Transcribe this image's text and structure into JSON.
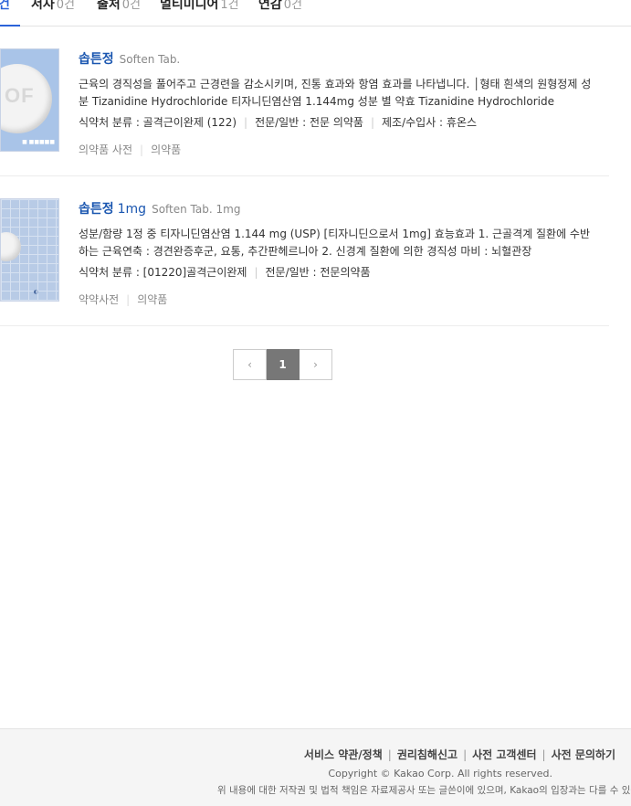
{
  "tabs": [
    {
      "label": "건",
      "count": ""
    },
    {
      "label": "서사",
      "count": "0건"
    },
    {
      "label": "출처",
      "count": "0건"
    },
    {
      "label": "멀티미디어",
      "count": "1건"
    },
    {
      "label": "연감",
      "count": "0건"
    }
  ],
  "results": [
    {
      "title": "솝튼정",
      "strength": "",
      "subtitle": "Soften Tab.",
      "thumb_text": "OF",
      "description": "근육의 경직성을 풀어주고 근경련을 감소시키며, 진통 효과와 항염 효과를 나타냅니다. │형태 흰색의 원형정제 성분 Tizanidine Hydrochloride 티자니딘염산염 1.144mg 성분 별 약효 Tizanidine Hydrochloride",
      "meta": [
        "식약처 분류 : 골격근이완제 (122)",
        "전문/일반 : 전문 의약품",
        "제조/수입사 : 휴온스"
      ],
      "categories": [
        "의약품 사전",
        "의약품"
      ]
    },
    {
      "title": "솝튼정",
      "strength": "1mg",
      "subtitle": "Soften Tab. 1mg",
      "thumb_text": "",
      "description": "성분/함량 1정 중 티자니딘염산염 1.144 mg (USP) [티자니딘으로서 1mg] 효능효과 1. 근골격계 질환에 수반하는 근육연축 : 경견완증후군, 요통, 추간판헤르니아 2. 신경계 질환에 의한 경직성 마비 : 뇌혈관장",
      "meta": [
        "식약처 분류 : [01220]골격근이완제",
        "전문/일반 : 전문의약품"
      ],
      "categories": [
        "약약사전",
        "의약품"
      ]
    }
  ],
  "pagination": {
    "prev": "‹",
    "current": "1",
    "next": "›"
  },
  "footer": {
    "links": [
      "서비스 약관/정책",
      "권리침해신고",
      "사전 고객센터",
      "사전 문의하기"
    ],
    "copyright": "Copyright © Kakao Corp. All rights reserved.",
    "notice": "위 내용에 대한 저작권 및 법적 책임은 자료제공사 또는 글쓴이에 있으며, Kakao의 입장과는 다를 수 있습니다."
  }
}
